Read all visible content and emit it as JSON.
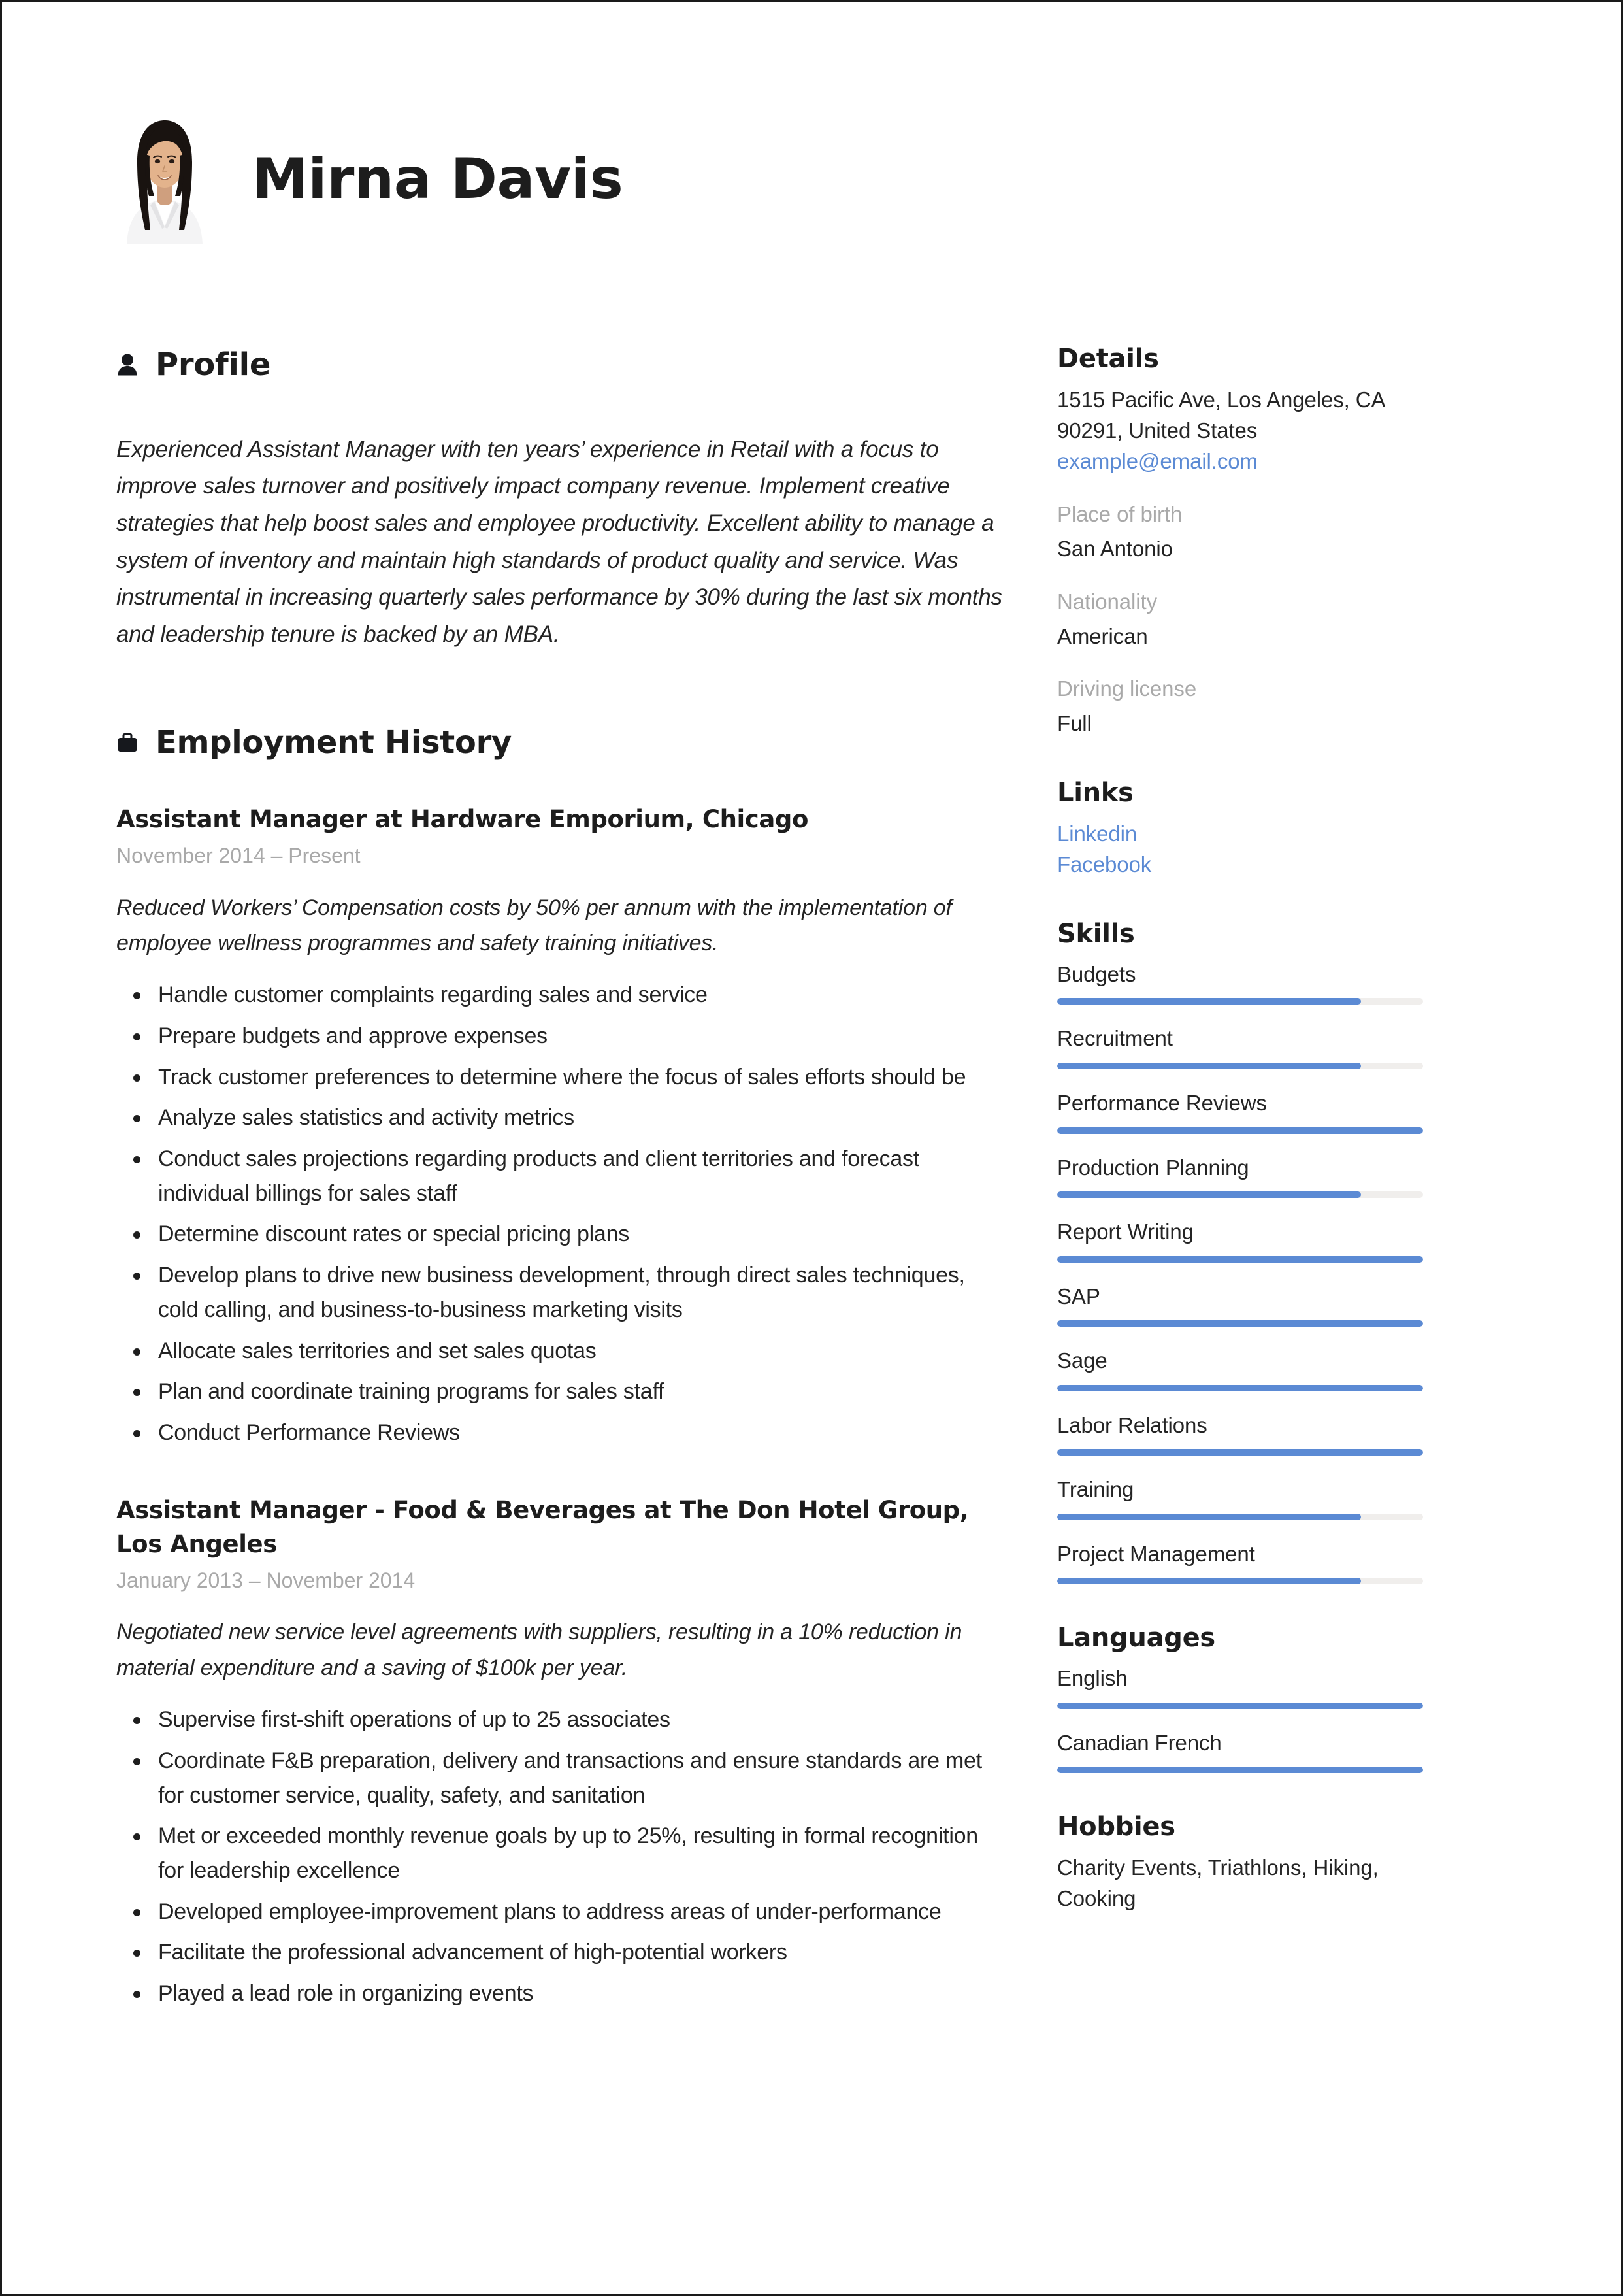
{
  "accent_color": "#5b8ad4",
  "muted_color": "#a9a9a9",
  "header": {
    "full_name": "Mirna Davis"
  },
  "main": {
    "profile": {
      "title": "Profile",
      "icon": "person-icon",
      "text": "Experienced Assistant Manager with ten years’ experience in Retail with a focus to improve sales turnover and positively impact company revenue. Implement creative strategies that help boost sales and employee productivity. Excellent ability to manage a system of inventory and maintain high standards of product quality and service. Was instrumental in increasing quarterly sales performance by 30% during the last six months and leadership tenure is backed by an MBA."
    },
    "employment": {
      "title": "Employment History",
      "icon": "briefcase-icon",
      "jobs": [
        {
          "title": "Assistant Manager at Hardware Emporium, Chicago",
          "dates": "November 2014  –  Present",
          "summary": "Reduced Workers’ Compensation costs by 50% per annum with the implementation of employee wellness programmes and safety training initiatives.",
          "bullets": [
            "Handle customer complaints regarding sales and service",
            "Prepare budgets and approve expenses",
            "Track customer preferences to determine where the focus of sales efforts should be",
            "Analyze sales statistics and activity metrics",
            "Conduct sales projections regarding products and client territories and forecast individual billings for sales staff",
            "Determine discount rates or special pricing plans",
            "Develop plans to drive new business development, through direct sales techniques, cold calling, and business-to-business marketing visits",
            "Allocate sales territories and set sales quotas",
            "Plan and coordinate training programs for sales staff",
            "Conduct Performance Reviews"
          ]
        },
        {
          "title": "Assistant Manager - Food & Beverages at The Don Hotel Group, Los Angeles",
          "dates": "January 2013  –  November 2014",
          "summary": "Negotiated new service level agreements with suppliers, resulting in a 10% reduction in material expenditure and a saving of $100k per year.",
          "bullets": [
            "Supervise first-shift operations of up to 25 associates",
            "Coordinate F&B preparation, delivery and transactions and ensure standards are met for customer service, quality, safety, and sanitation",
            "Met or exceeded monthly revenue goals by up to 25%, resulting in formal recognition for leadership excellence",
            "Developed employee-improvement plans to address areas of under-performance",
            "Facilitate the professional advancement of high-potential workers",
            "Played a lead role in organizing events"
          ]
        }
      ]
    }
  },
  "sidebar": {
    "details": {
      "title": "Details",
      "address_line_1": "1515 Pacific Ave, Los Angeles, CA",
      "address_line_2": "90291, United States",
      "email": "example@email.com",
      "fields": [
        {
          "label": "Place of birth",
          "value": "San Antonio"
        },
        {
          "label": "Nationality",
          "value": "American"
        },
        {
          "label": "Driving license",
          "value": "Full"
        }
      ]
    },
    "links": {
      "title": "Links",
      "items": [
        {
          "label": "Linkedin"
        },
        {
          "label": "Facebook"
        }
      ]
    },
    "skills": {
      "title": "Skills",
      "items": [
        {
          "label": "Budgets",
          "level": 83
        },
        {
          "label": "Recruitment",
          "level": 83
        },
        {
          "label": "Performance Reviews",
          "level": 100
        },
        {
          "label": "Production Planning",
          "level": 83
        },
        {
          "label": "Report Writing",
          "level": 100
        },
        {
          "label": "SAP",
          "level": 100
        },
        {
          "label": "Sage",
          "level": 100
        },
        {
          "label": "Labor Relations",
          "level": 100
        },
        {
          "label": "Training",
          "level": 83
        },
        {
          "label": "Project Management",
          "level": 83
        }
      ]
    },
    "languages": {
      "title": "Languages",
      "items": [
        {
          "label": "English",
          "level": 100
        },
        {
          "label": "Canadian French",
          "level": 100
        }
      ]
    },
    "hobbies": {
      "title": "Hobbies",
      "text": "Charity Events, Triathlons, Hiking, Cooking"
    }
  }
}
